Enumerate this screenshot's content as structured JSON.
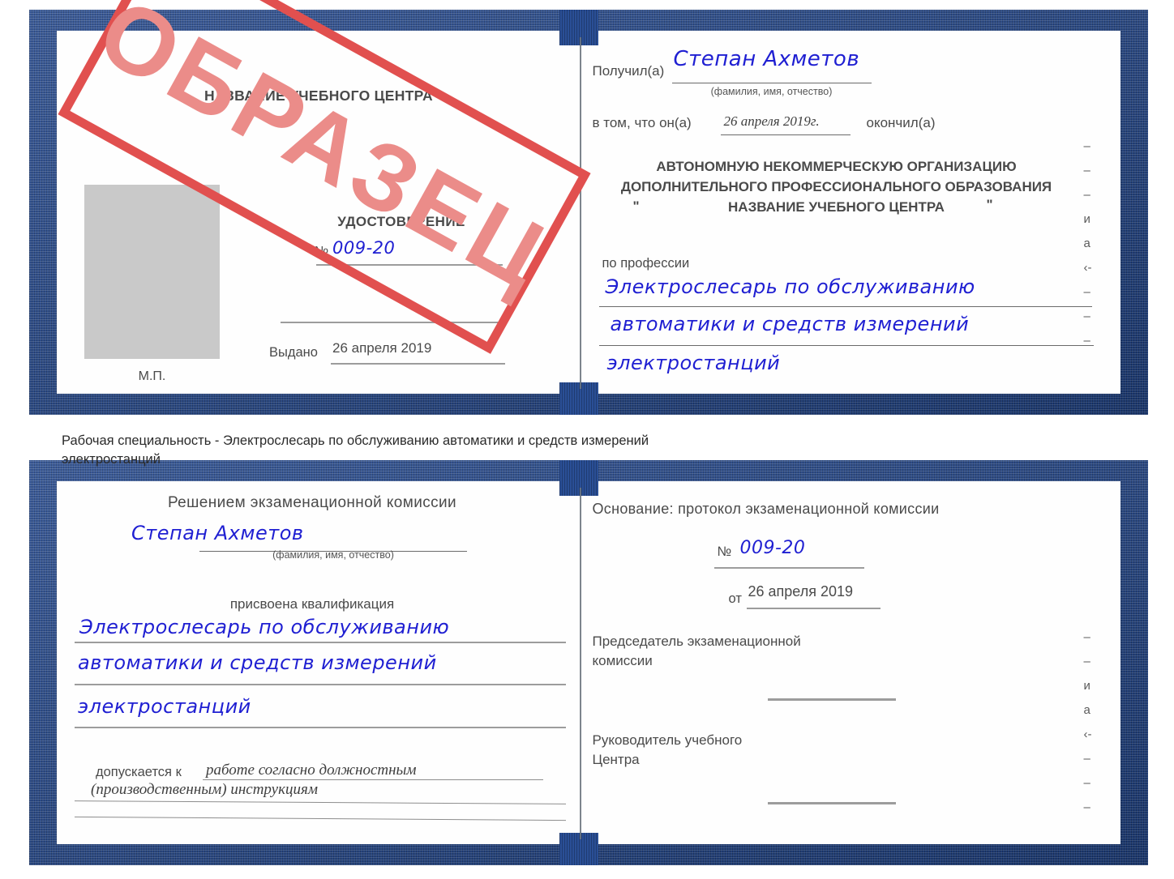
{
  "document": {
    "kind": "certificate-sample-scan",
    "stamp": {
      "text": "ОБРАЗЕЦ",
      "color": "#e1504f",
      "fill_color": "#eb8c89"
    },
    "ink_color": "#1f1fd2",
    "cover_color": "#23478c"
  },
  "certificate_top": {
    "left_page": {
      "header": "НАЗВАНИЕ УЧЕБНОГО ЦЕНТРА",
      "title": "УДОСТОВЕРЕНИЕ",
      "number_label": "№",
      "number_value": "009-20",
      "issued_label": "Выдано",
      "issued_value": "26 апреля 2019",
      "seal_label": "М.П."
    },
    "right_page": {
      "received_label": "Получил(а)",
      "received_value": "Степан Ахметов",
      "fio_hint": "(фамилия, имя, отчество)",
      "that_he_label": "в том, что он(а)",
      "finish_date_value": "26 апреля 2019г.",
      "finished_label": "окончил(а)",
      "org_line1": "АВТОНОМНУЮ НЕКОММЕРЧЕСКУЮ ОРГАНИЗАЦИЮ",
      "org_line2": "ДОПОЛНИТЕЛЬНОГО ПРОФЕССИОНАЛЬНОГО ОБРАЗОВАНИЯ",
      "org_quote_open": "\"",
      "org_line3": "НАЗВАНИЕ УЧЕБНОГО ЦЕНТРА",
      "org_quote_close": "\"",
      "profession_label": "по профессии",
      "profession_line1": "Электрослесарь по обслуживанию",
      "profession_line2": "автоматики и средств измерений",
      "profession_line3": "электростанций",
      "edge_glyphs": [
        "–",
        "–",
        "–",
        "и",
        "а",
        "‹-",
        "–",
        "–",
        "–"
      ]
    }
  },
  "caption": {
    "line1": "Рабочая специальность - Электрослесарь по обслуживанию автоматики и средств измерений",
    "line2": "электростанций"
  },
  "certificate_bottom": {
    "left_page": {
      "decision_header": "Решением экзаменационной комиссии",
      "name_value": "Степан Ахметов",
      "fio_hint": "(фамилия, имя, отчество)",
      "qualification_label": "присвоена квалификация",
      "qualification_line1": "Электрослесарь по обслуживанию",
      "qualification_line2": "автоматики и средств измерений",
      "qualification_line3": "электростанций",
      "admitted_label": "допускается к",
      "admitted_value1": "работе согласно должностным",
      "admitted_value2": "(производственным) инструкциям"
    },
    "right_page": {
      "basis_label": "Основание: протокол экзаменационной комиссии",
      "number_label": "№",
      "number_value": "009-20",
      "date_label": "от",
      "date_value": "26 апреля 2019",
      "chairman_line1": "Председатель экзаменационной",
      "chairman_line2": "комиссии",
      "head_line1": "Руководитель учебного",
      "head_line2": "Центра",
      "edge_glyphs": [
        "–",
        "–",
        "и",
        "а",
        "‹-",
        "–",
        "–",
        "–"
      ]
    }
  }
}
